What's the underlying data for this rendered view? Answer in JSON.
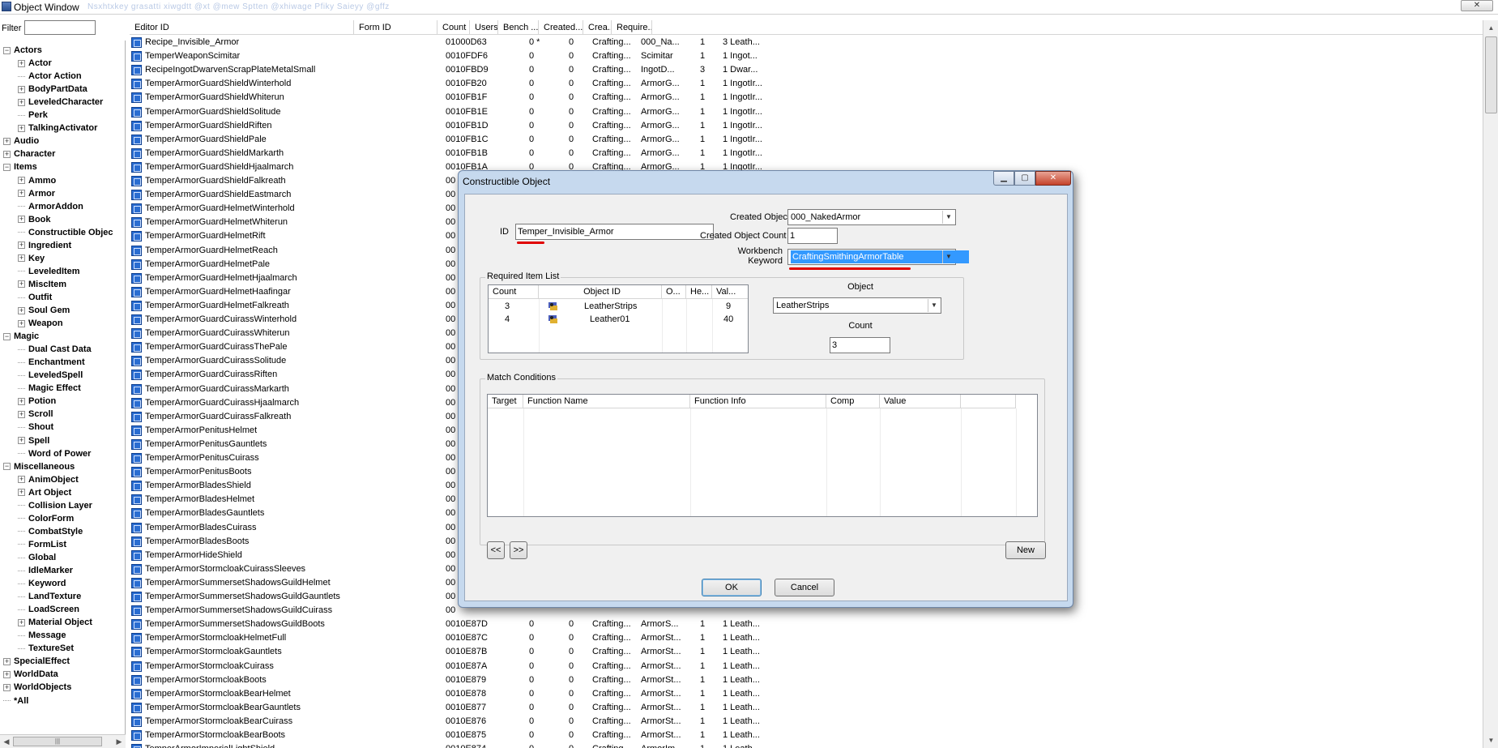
{
  "window": {
    "title": "Object Window",
    "menu_blur": "Nsxhtxkey  grasatti  xiwgdtt  @xt  @mew  Sptten  @xhiwage  Pfiky  Saieyy  @gffz"
  },
  "filter": {
    "label": "Filter",
    "value": ""
  },
  "tree": [
    {
      "label": "Actors",
      "level": 0,
      "expander": "minus"
    },
    {
      "label": "Actor",
      "level": 1,
      "expander": "plus"
    },
    {
      "label": "Actor Action",
      "level": 1,
      "expander": "none"
    },
    {
      "label": "BodyPartData",
      "level": 1,
      "expander": "plus"
    },
    {
      "label": "LeveledCharacter",
      "level": 1,
      "expander": "plus"
    },
    {
      "label": "Perk",
      "level": 1,
      "expander": "none"
    },
    {
      "label": "TalkingActivator",
      "level": 1,
      "expander": "plus"
    },
    {
      "label": "Audio",
      "level": 0,
      "expander": "plus"
    },
    {
      "label": "Character",
      "level": 0,
      "expander": "plus"
    },
    {
      "label": "Items",
      "level": 0,
      "expander": "minus"
    },
    {
      "label": "Ammo",
      "level": 1,
      "expander": "plus"
    },
    {
      "label": "Armor",
      "level": 1,
      "expander": "plus"
    },
    {
      "label": "ArmorAddon",
      "level": 1,
      "expander": "none"
    },
    {
      "label": "Book",
      "level": 1,
      "expander": "plus"
    },
    {
      "label": "Constructible Objec",
      "level": 1,
      "expander": "none"
    },
    {
      "label": "Ingredient",
      "level": 1,
      "expander": "plus"
    },
    {
      "label": "Key",
      "level": 1,
      "expander": "plus"
    },
    {
      "label": "LeveledItem",
      "level": 1,
      "expander": "none"
    },
    {
      "label": "MiscItem",
      "level": 1,
      "expander": "plus"
    },
    {
      "label": "Outfit",
      "level": 1,
      "expander": "none"
    },
    {
      "label": "Soul Gem",
      "level": 1,
      "expander": "plus"
    },
    {
      "label": "Weapon",
      "level": 1,
      "expander": "plus"
    },
    {
      "label": "Magic",
      "level": 0,
      "expander": "minus"
    },
    {
      "label": "Dual Cast Data",
      "level": 1,
      "expander": "none"
    },
    {
      "label": "Enchantment",
      "level": 1,
      "expander": "none"
    },
    {
      "label": "LeveledSpell",
      "level": 1,
      "expander": "none"
    },
    {
      "label": "Magic Effect",
      "level": 1,
      "expander": "none"
    },
    {
      "label": "Potion",
      "level": 1,
      "expander": "plus"
    },
    {
      "label": "Scroll",
      "level": 1,
      "expander": "plus"
    },
    {
      "label": "Shout",
      "level": 1,
      "expander": "none"
    },
    {
      "label": "Spell",
      "level": 1,
      "expander": "plus"
    },
    {
      "label": "Word of Power",
      "level": 1,
      "expander": "none"
    },
    {
      "label": "Miscellaneous",
      "level": 0,
      "expander": "minus"
    },
    {
      "label": "AnimObject",
      "level": 1,
      "expander": "plus"
    },
    {
      "label": "Art Object",
      "level": 1,
      "expander": "plus"
    },
    {
      "label": "Collision Layer",
      "level": 1,
      "expander": "none"
    },
    {
      "label": "ColorForm",
      "level": 1,
      "expander": "none"
    },
    {
      "label": "CombatStyle",
      "level": 1,
      "expander": "none"
    },
    {
      "label": "FormList",
      "level": 1,
      "expander": "none"
    },
    {
      "label": "Global",
      "level": 1,
      "expander": "none"
    },
    {
      "label": "IdleMarker",
      "level": 1,
      "expander": "none"
    },
    {
      "label": "Keyword",
      "level": 1,
      "expander": "none"
    },
    {
      "label": "LandTexture",
      "level": 1,
      "expander": "none"
    },
    {
      "label": "LoadScreen",
      "level": 1,
      "expander": "none"
    },
    {
      "label": "Material Object",
      "level": 1,
      "expander": "plus"
    },
    {
      "label": "Message",
      "level": 1,
      "expander": "none"
    },
    {
      "label": "TextureSet",
      "level": 1,
      "expander": "none"
    },
    {
      "label": "SpecialEffect",
      "level": 0,
      "expander": "plus"
    },
    {
      "label": "WorldData",
      "level": 0,
      "expander": "plus"
    },
    {
      "label": "WorldObjects",
      "level": 0,
      "expander": "plus"
    },
    {
      "label": "*All",
      "level": 0,
      "expander": "none"
    }
  ],
  "list": {
    "columns": [
      "Editor ID",
      "Form ID",
      "Count",
      "Users",
      "Bench ...",
      "Created...",
      "Crea...",
      "Require..."
    ],
    "rows": [
      [
        "Recipe_Invisible_Armor",
        "01000D63",
        "0 *",
        "0",
        "Crafting...",
        "000_Na...",
        "1",
        "3 Leath..."
      ],
      [
        "TemperWeaponScimitar",
        "0010FDF6",
        "0",
        "0",
        "Crafting...",
        "Scimitar",
        "1",
        "1 Ingot..."
      ],
      [
        "RecipeIngotDwarvenScrapPlateMetalSmall",
        "0010FBD9",
        "0",
        "0",
        "Crafting...",
        "IngotD...",
        "3",
        "1 Dwar..."
      ],
      [
        "TemperArmorGuardShieldWinterhold",
        "0010FB20",
        "0",
        "0",
        "Crafting...",
        "ArmorG...",
        "1",
        "1 IngotIr..."
      ],
      [
        "TemperArmorGuardShieldWhiterun",
        "0010FB1F",
        "0",
        "0",
        "Crafting...",
        "ArmorG...",
        "1",
        "1 IngotIr..."
      ],
      [
        "TemperArmorGuardShieldSolitude",
        "0010FB1E",
        "0",
        "0",
        "Crafting...",
        "ArmorG...",
        "1",
        "1 IngotIr..."
      ],
      [
        "TemperArmorGuardShieldRiften",
        "0010FB1D",
        "0",
        "0",
        "Crafting...",
        "ArmorG...",
        "1",
        "1 IngotIr..."
      ],
      [
        "TemperArmorGuardShieldPale",
        "0010FB1C",
        "0",
        "0",
        "Crafting...",
        "ArmorG...",
        "1",
        "1 IngotIr..."
      ],
      [
        "TemperArmorGuardShieldMarkarth",
        "0010FB1B",
        "0",
        "0",
        "Crafting...",
        "ArmorG...",
        "1",
        "1 IngotIr..."
      ],
      [
        "TemperArmorGuardShieldHjaalmarch",
        "0010FB1A",
        "0",
        "0",
        "Crafting...",
        "ArmorG...",
        "1",
        "1 IngotIr..."
      ],
      [
        "TemperArmorGuardShieldFalkreath",
        "00",
        "",
        "",
        "",
        "",
        "",
        ""
      ],
      [
        "TemperArmorGuardShieldEastmarch",
        "00",
        "",
        "",
        "",
        "",
        "",
        ""
      ],
      [
        "TemperArmorGuardHelmetWinterhold",
        "00",
        "",
        "",
        "",
        "",
        "",
        ""
      ],
      [
        "TemperArmorGuardHelmetWhiterun",
        "00",
        "",
        "",
        "",
        "",
        "",
        ""
      ],
      [
        "TemperArmorGuardHelmetRift",
        "00",
        "",
        "",
        "",
        "",
        "",
        ""
      ],
      [
        "TemperArmorGuardHelmetReach",
        "00",
        "",
        "",
        "",
        "",
        "",
        ""
      ],
      [
        "TemperArmorGuardHelmetPale",
        "00",
        "",
        "",
        "",
        "",
        "",
        ""
      ],
      [
        "TemperArmorGuardHelmetHjaalmarch",
        "00",
        "",
        "",
        "",
        "",
        "",
        ""
      ],
      [
        "TemperArmorGuardHelmetHaafingar",
        "00",
        "",
        "",
        "",
        "",
        "",
        ""
      ],
      [
        "TemperArmorGuardHelmetFalkreath",
        "00",
        "",
        "",
        "",
        "",
        "",
        ""
      ],
      [
        "TemperArmorGuardCuirassWinterhold",
        "00",
        "",
        "",
        "",
        "",
        "",
        ""
      ],
      [
        "TemperArmorGuardCuirassWhiterun",
        "00",
        "",
        "",
        "",
        "",
        "",
        ""
      ],
      [
        "TemperArmorGuardCuirassThePale",
        "00",
        "",
        "",
        "",
        "",
        "",
        ""
      ],
      [
        "TemperArmorGuardCuirassSolitude",
        "00",
        "",
        "",
        "",
        "",
        "",
        ""
      ],
      [
        "TemperArmorGuardCuirassRiften",
        "00",
        "",
        "",
        "",
        "",
        "",
        ""
      ],
      [
        "TemperArmorGuardCuirassMarkarth",
        "00",
        "",
        "",
        "",
        "",
        "",
        ""
      ],
      [
        "TemperArmorGuardCuirassHjaalmarch",
        "00",
        "",
        "",
        "",
        "",
        "",
        ""
      ],
      [
        "TemperArmorGuardCuirassFalkreath",
        "00",
        "",
        "",
        "",
        "",
        "",
        ""
      ],
      [
        "TemperArmorPenitusHelmet",
        "00",
        "",
        "",
        "",
        "",
        "",
        ""
      ],
      [
        "TemperArmorPenitusGauntlets",
        "00",
        "",
        "",
        "",
        "",
        "",
        ""
      ],
      [
        "TemperArmorPenitusCuirass",
        "00",
        "",
        "",
        "",
        "",
        "",
        ""
      ],
      [
        "TemperArmorPenitusBoots",
        "00",
        "",
        "",
        "",
        "",
        "",
        ""
      ],
      [
        "TemperArmorBladesShield",
        "00",
        "",
        "",
        "",
        "",
        "",
        ""
      ],
      [
        "TemperArmorBladesHelmet",
        "00",
        "",
        "",
        "",
        "",
        "",
        ""
      ],
      [
        "TemperArmorBladesGauntlets",
        "00",
        "",
        "",
        "",
        "",
        "",
        ""
      ],
      [
        "TemperArmorBladesCuirass",
        "00",
        "",
        "",
        "",
        "",
        "",
        ""
      ],
      [
        "TemperArmorBladesBoots",
        "00",
        "",
        "",
        "",
        "",
        "",
        ""
      ],
      [
        "TemperArmorHideShield",
        "00",
        "",
        "",
        "",
        "",
        "",
        ""
      ],
      [
        "TemperArmorStormcloakCuirassSleeves",
        "00",
        "",
        "",
        "",
        "",
        "",
        ""
      ],
      [
        "TemperArmorSummersetShadowsGuildHelmet",
        "00",
        "",
        "",
        "",
        "",
        "",
        ""
      ],
      [
        "TemperArmorSummersetShadowsGuildGauntlets",
        "00",
        "",
        "",
        "",
        "",
        "",
        ""
      ],
      [
        "TemperArmorSummersetShadowsGuildCuirass",
        "00",
        "",
        "",
        "",
        "",
        "",
        ""
      ],
      [
        "TemperArmorSummersetShadowsGuildBoots",
        "0010E87D",
        "0",
        "0",
        "Crafting...",
        "ArmorS...",
        "1",
        "1 Leath..."
      ],
      [
        "TemperArmorStormcloakHelmetFull",
        "0010E87C",
        "0",
        "0",
        "Crafting...",
        "ArmorSt...",
        "1",
        "1 Leath..."
      ],
      [
        "TemperArmorStormcloakGauntlets",
        "0010E87B",
        "0",
        "0",
        "Crafting...",
        "ArmorSt...",
        "1",
        "1 Leath..."
      ],
      [
        "TemperArmorStormcloakCuirass",
        "0010E87A",
        "0",
        "0",
        "Crafting...",
        "ArmorSt...",
        "1",
        "1 Leath..."
      ],
      [
        "TemperArmorStormcloakBoots",
        "0010E879",
        "0",
        "0",
        "Crafting...",
        "ArmorSt...",
        "1",
        "1 Leath..."
      ],
      [
        "TemperArmorStormcloakBearHelmet",
        "0010E878",
        "0",
        "0",
        "Crafting...",
        "ArmorSt...",
        "1",
        "1 Leath..."
      ],
      [
        "TemperArmorStormcloakBearGauntlets",
        "0010E877",
        "0",
        "0",
        "Crafting...",
        "ArmorSt...",
        "1",
        "1 Leath..."
      ],
      [
        "TemperArmorStormcloakBearCuirass",
        "0010E876",
        "0",
        "0",
        "Crafting...",
        "ArmorSt...",
        "1",
        "1 Leath..."
      ],
      [
        "TemperArmorStormcloakBearBoots",
        "0010E875",
        "0",
        "0",
        "Crafting...",
        "ArmorSt...",
        "1",
        "1 Leath..."
      ],
      [
        "TemperArmorImperialLightShield",
        "0010E874",
        "0",
        "0",
        "Crafting...",
        "ArmorIm...",
        "1",
        "1 Leath..."
      ]
    ]
  },
  "dialog": {
    "title": "Constructible Object",
    "id_label": "ID",
    "id_value": "Temper_Invisible_Armor",
    "created_object_label": "Created Object",
    "created_object_value": "000_NakedArmor",
    "created_count_label": "Created Object Count",
    "created_count_value": "1",
    "workbench_label_1": "Workbench",
    "workbench_label_2": "Keyword",
    "workbench_value": "CraftingSmithingArmorTable",
    "required_group": "Required Item List",
    "req_columns": [
      "Count",
      "Object ID",
      "O...",
      "He...",
      "Val..."
    ],
    "req_rows": [
      {
        "count": "3",
        "object": "LeatherStrips",
        "val": "9"
      },
      {
        "count": "4",
        "object": "Leather01",
        "val": "40"
      }
    ],
    "object_label": "Object",
    "object_value": "LeatherStrips",
    "count_label": "Count",
    "count_value": "3",
    "match_group": "Match Conditions",
    "match_columns": [
      "Target",
      "Function Name",
      "Function Info",
      "Comp",
      "Value"
    ],
    "prev_button": "<<",
    "next_button": ">>",
    "new_button": "New",
    "ok_button": "OK",
    "cancel_button": "Cancel"
  },
  "colors": {
    "highlight": "#3399ff",
    "annotation_red": "#e00000",
    "dialog_frame": "#c6d9ee"
  }
}
